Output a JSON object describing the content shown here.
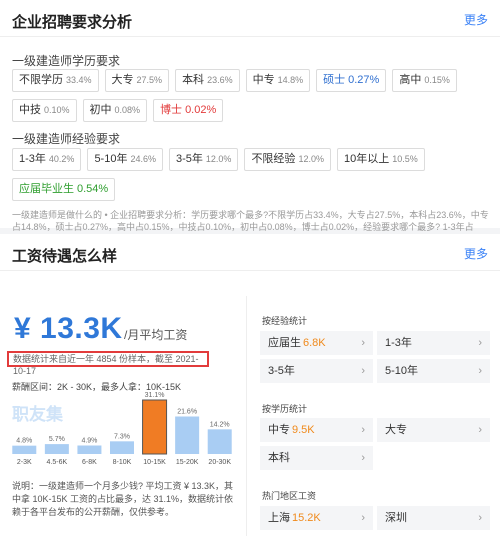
{
  "card1": {
    "title": "企业招聘要求分析",
    "more": "更多",
    "education": {
      "label": "一级建造师学历要求",
      "tags": [
        {
          "name": "不限学历",
          "pct": "33.4%",
          "style": "normal"
        },
        {
          "name": "大专",
          "pct": "27.5%",
          "style": "normal"
        },
        {
          "name": "本科",
          "pct": "23.6%",
          "style": "normal"
        },
        {
          "name": "中专",
          "pct": "14.8%",
          "style": "normal"
        },
        {
          "name": "硕士",
          "pct": "0.27%",
          "style": "blue"
        },
        {
          "name": "高中",
          "pct": "0.15%",
          "style": "normal"
        },
        {
          "name": "中技",
          "pct": "0.10%",
          "style": "normal"
        },
        {
          "name": "初中",
          "pct": "0.08%",
          "style": "normal"
        },
        {
          "name": "博士",
          "pct": "0.02%",
          "style": "red"
        }
      ]
    },
    "experience": {
      "label": "一级建造师经验要求",
      "tags": [
        {
          "name": "1-3年",
          "pct": "40.2%",
          "style": "normal"
        },
        {
          "name": "5-10年",
          "pct": "24.6%",
          "style": "normal"
        },
        {
          "name": "3-5年",
          "pct": "12.0%",
          "style": "normal"
        },
        {
          "name": "不限经验",
          "pct": "12.0%",
          "style": "normal"
        },
        {
          "name": "10年以上",
          "pct": "10.5%",
          "style": "normal"
        },
        {
          "name": "应届毕业生",
          "pct": "0.54%",
          "style": "green"
        }
      ]
    },
    "summary": "一级建造师是做什么的 • 企业招聘要求分析：学历要求哪个最多?不限学历占33.4%，大专占27.5%，本科占23.6%，中专占14.8%，硕士占0.27%，高中占0.15%，中技占0.10%，初中占0.08%，博士占0.02%，经验要求哪个最多? 1-3年占40.2%，5-10年占24.6%，3-5年占12.0%，不限经验占12.0%，10年以上占10.5%，应届毕业生占0.54%"
  },
  "card2": {
    "title": "工资待遇怎么样",
    "more": "更多",
    "salary": "¥ 13.3K",
    "salary_unit": "/月平均工资",
    "stats_note": "数据统计来自近一年 4854 份样本，截至 2021-10-17",
    "range_line": "薪酬区间：2K - 30K，最多人拿：10K-15K",
    "watermark": "职友集",
    "description": "说明：一级建造师一个月多少钱? 平均工资 ¥ 13.3K，其中拿 10K-15K 工资的占比最多，达 31.1%，数据统计依赖于各平台发布的公开薪酬，仅供参考。",
    "by_experience": {
      "label": "按经验统计",
      "items": [
        {
          "name": "应届生",
          "salary": "6.8K"
        },
        {
          "name": "1-3年",
          "salary": ""
        },
        {
          "name": "3-5年",
          "salary": ""
        },
        {
          "name": "5-10年",
          "salary": ""
        }
      ]
    },
    "by_education": {
      "label": "按学历统计",
      "items": [
        {
          "name": "中专",
          "salary": "9.5K"
        },
        {
          "name": "大专",
          "salary": ""
        },
        {
          "name": "本科",
          "salary": ""
        }
      ]
    },
    "by_region": {
      "label": "热门地区工资",
      "items": [
        {
          "name": "上海",
          "salary": "15.2K"
        },
        {
          "name": "深圳",
          "salary": ""
        }
      ]
    },
    "chevron": "›"
  },
  "chart_data": {
    "type": "bar",
    "categories": [
      "2-3K",
      "4.5-6K",
      "6-8K",
      "8-10K",
      "10-15K",
      "15-20K",
      "20-30K"
    ],
    "values": [
      4.8,
      5.7,
      4.9,
      7.3,
      31.1,
      21.6,
      14.2
    ],
    "value_labels": [
      "4.8%",
      "5.7%",
      "4.9%",
      "7.3%",
      "31.1%",
      "21.6%",
      "14.2%"
    ],
    "highlight_index": 4,
    "colors": {
      "bar": "#a9cdf3",
      "highlight": "#f07c24",
      "highlight_border": "#555555"
    },
    "ylim": [
      0,
      31.1
    ],
    "grid": false
  }
}
